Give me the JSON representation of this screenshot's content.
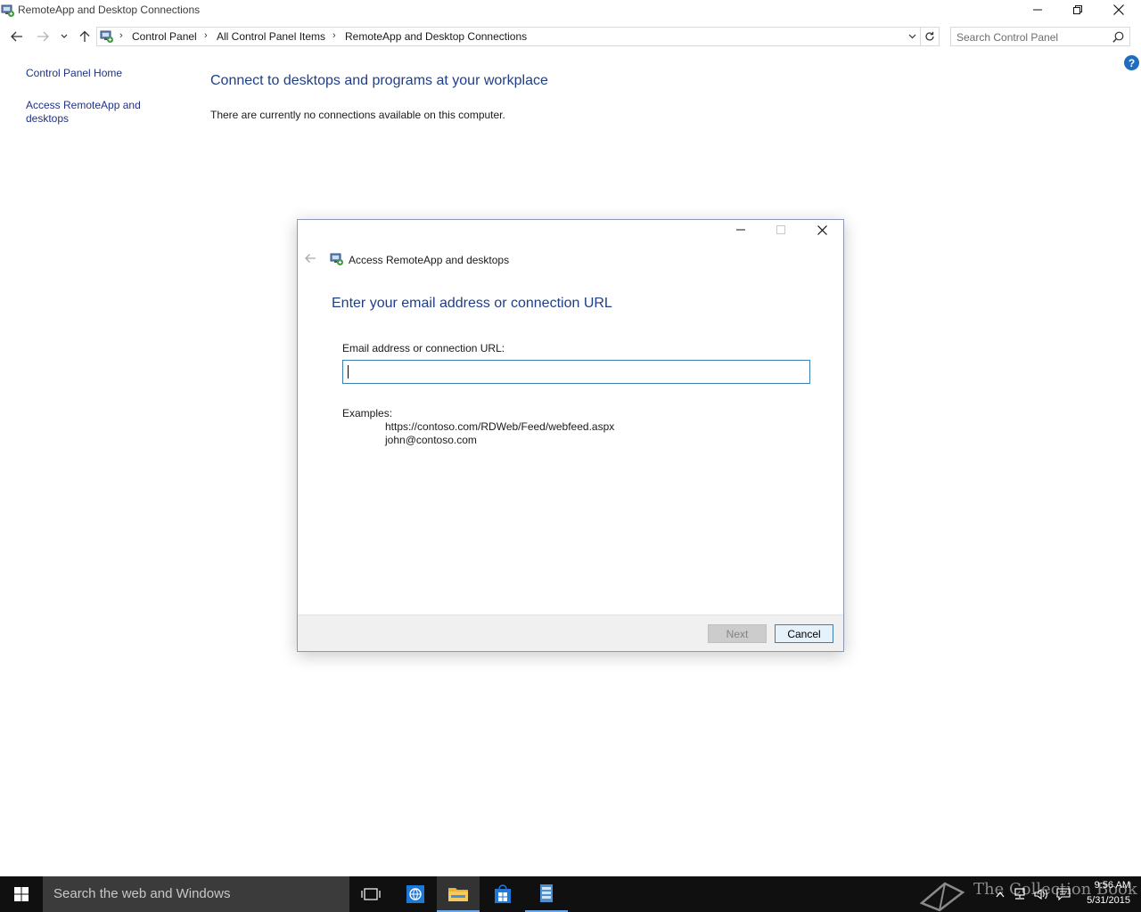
{
  "window": {
    "title": "RemoteApp and Desktop Connections"
  },
  "address_bar": {
    "breadcrumbs": [
      "Control Panel",
      "All Control Panel Items",
      "RemoteApp and Desktop Connections"
    ],
    "search_placeholder": "Search Control Panel"
  },
  "left_pane": {
    "links": [
      "Control Panel Home",
      "Access RemoteApp and",
      "desktops"
    ]
  },
  "help_label": "?",
  "main": {
    "heading": "Connect to desktops and programs at your workplace",
    "status_text": "There are currently no connections available on this computer."
  },
  "dialog": {
    "title": "Access RemoteApp and desktops",
    "heading": "Enter your email address or connection URL",
    "field_label": "Email address or connection URL:",
    "field_value": "",
    "examples_label": "Examples:",
    "examples": [
      "https://contoso.com/RDWeb/Feed/webfeed.aspx",
      "john@contoso.com"
    ],
    "next_label": "Next",
    "cancel_label": "Cancel"
  },
  "taskbar": {
    "search_placeholder": "Search the web and Windows",
    "watermark": "The Collection Book",
    "time": "9:56 AM",
    "date": "5/31/2015"
  },
  "colors": {
    "heading_blue": "#1e3f87",
    "link_blue": "#1e3287",
    "taskbar": "#101010",
    "accent": "#3c7fb1"
  }
}
